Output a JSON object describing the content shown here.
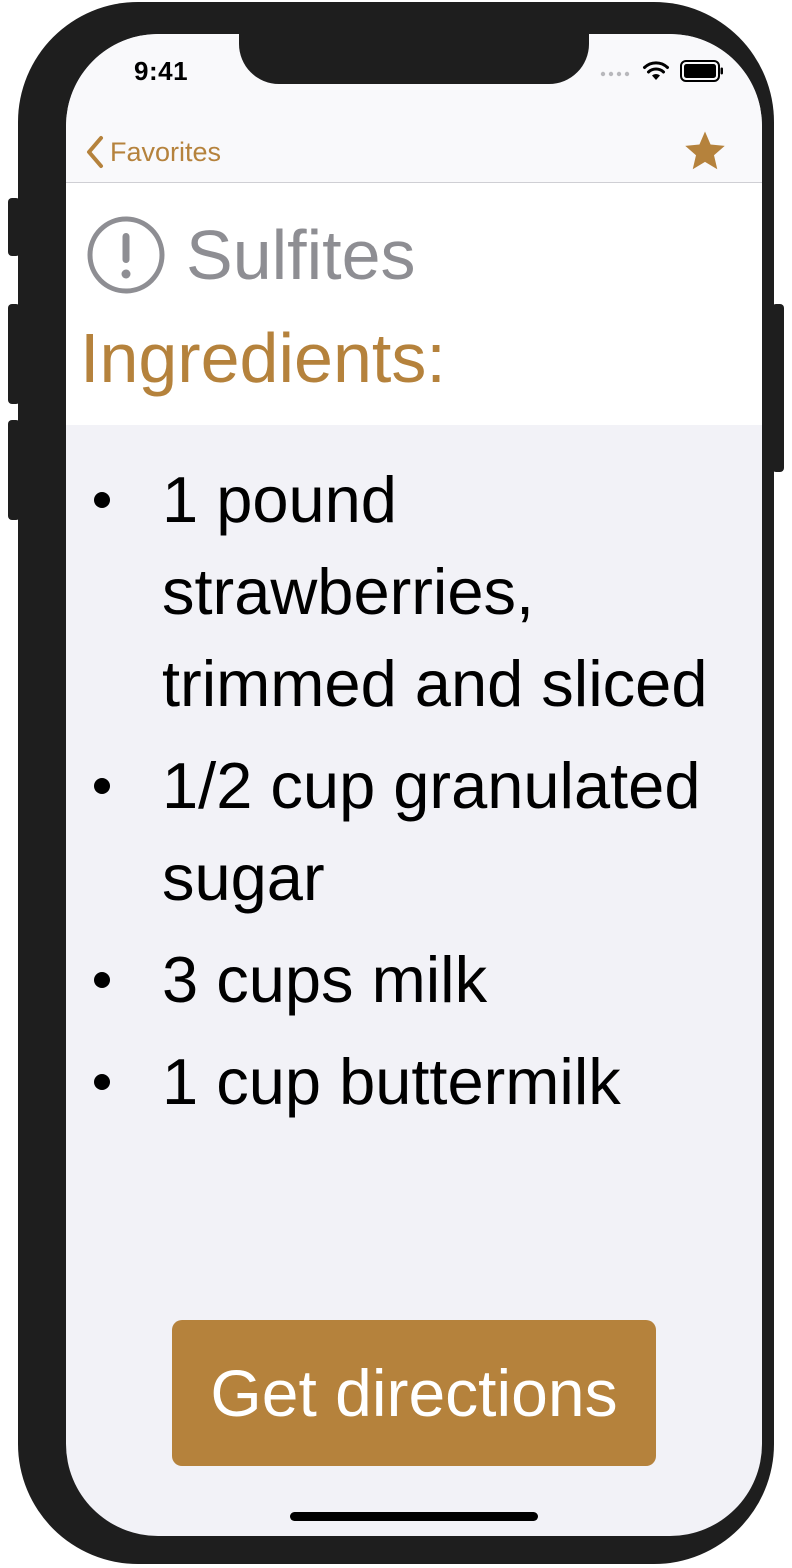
{
  "status_bar": {
    "time": "9:41"
  },
  "nav": {
    "back_label": "Favorites",
    "back_icon": "chevron-left-icon",
    "favorite_icon": "star-icon"
  },
  "allergen": {
    "icon": "exclamation-circle-icon",
    "label": "Sulfites"
  },
  "ingredients": {
    "title": "Ingredients:",
    "items": [
      "1 pound strawberries, trimmed and sliced",
      "1/2 cup granulated sugar",
      "3 cups milk",
      "1 cup buttermilk"
    ]
  },
  "actions": {
    "directions_label": "Get directions"
  },
  "colors": {
    "accent": "#b5823c",
    "frame": "#1e1e1e",
    "background": "#f2f2f7",
    "muted_text": "#8e8e93"
  }
}
